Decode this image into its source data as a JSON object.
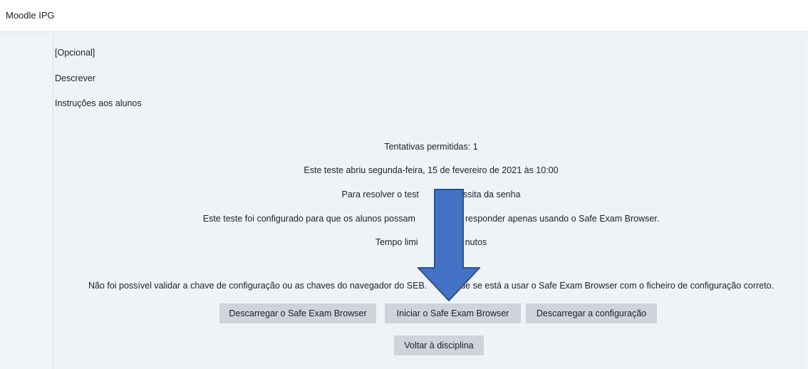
{
  "header": {
    "site_title": "Moodle IPG"
  },
  "intro": {
    "optional": "[Opcional]",
    "describe": "Descrever",
    "instructions": "Instruções aos alunos"
  },
  "quiz_info": {
    "attempts": "Tentativas permitidas: 1",
    "opened": "Este teste abriu segunda-feira, 15 de fevereiro de 2021 às 10:00",
    "password_partial": [
      "Para resolver o test",
      "ssita da senha"
    ],
    "seb_partial": [
      "Este teste foi configurado para que os alunos possam",
      "responder apenas usando o Safe Exam Browser."
    ],
    "time_partial": [
      "Tempo limi",
      "nutos"
    ]
  },
  "seb_error_partial": [
    "Não foi possível validar a chave de configuração ou as chaves do navegador do SEB.",
    "que se está a usar o Safe Exam Browser com o ficheiro de configuração correto."
  ],
  "buttons": {
    "download_seb": "Descarregar o Safe Exam Browser",
    "launch_seb": "Iniciar o Safe Exam Browser",
    "download_config": "Descarregar a configuração",
    "back": "Voltar à disciplina"
  },
  "colors": {
    "arrow_fill": "#4472c4",
    "arrow_stroke": "#2f528f",
    "button_bg": "#ced4da",
    "page_bg": "#eef3f8"
  }
}
